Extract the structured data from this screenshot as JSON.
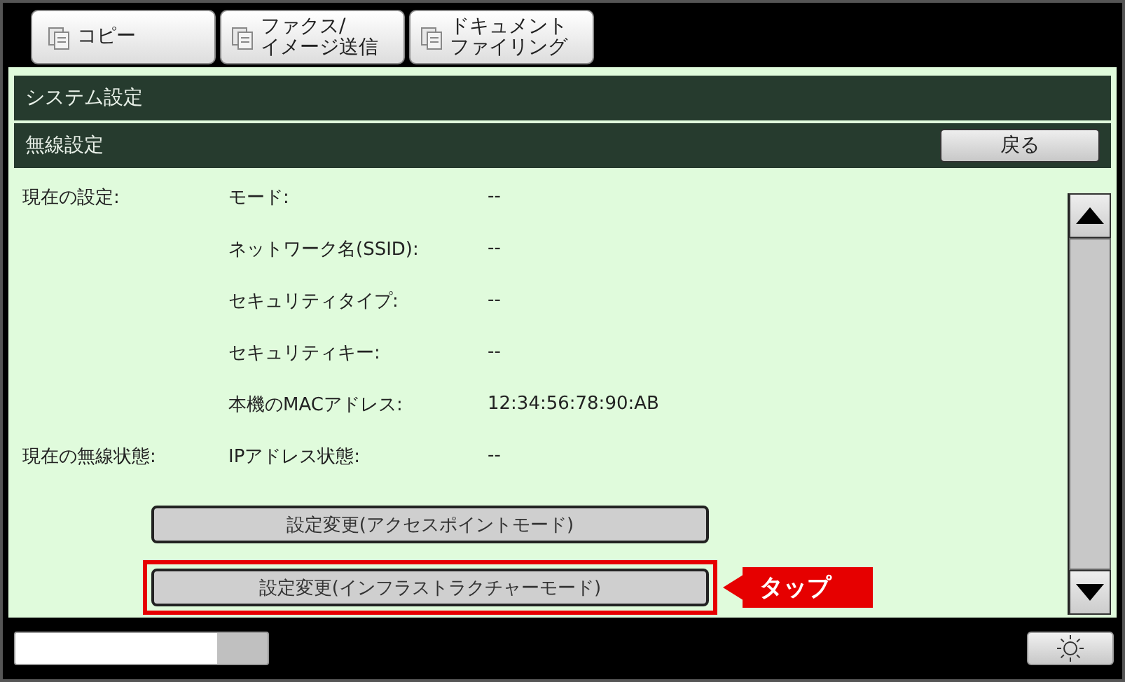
{
  "tabs": [
    {
      "lines": [
        "コピー"
      ]
    },
    {
      "lines": [
        "ファクス/",
        "イメージ送信"
      ]
    },
    {
      "lines": [
        "ドキュメント",
        "ファイリング"
      ]
    }
  ],
  "breadcrumb": "システム設定",
  "screen_title": "無線設定",
  "back_button": "戻る",
  "groups": [
    {
      "label": "現在の設定:",
      "rows": [
        {
          "name": "モード:",
          "value": "--"
        },
        {
          "name": "ネットワーク名(SSID):",
          "value": "--"
        },
        {
          "name": "セキュリティタイプ:",
          "value": "--"
        },
        {
          "name": "セキュリティキー:",
          "value": "--"
        },
        {
          "name": "本機のMACアドレス:",
          "value": "12:34:56:78:90:AB"
        }
      ]
    },
    {
      "label": "現在の無線状態:",
      "rows": [
        {
          "name": "IPアドレス状態:",
          "value": "--"
        }
      ]
    }
  ],
  "actions": [
    {
      "label": "設定変更(アクセスポイントモード)",
      "highlighted": false
    },
    {
      "label": "設定変更(インフラストラクチャーモード)",
      "highlighted": true
    }
  ],
  "callout": "タップ",
  "status_bar": {
    "level": 0.8
  }
}
